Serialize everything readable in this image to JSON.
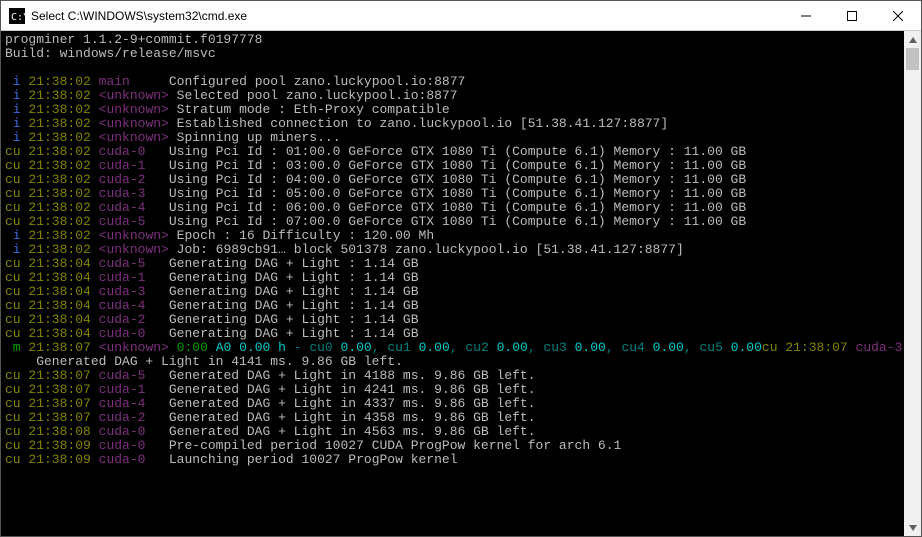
{
  "window": {
    "title": "Select C:\\WINDOWS\\system32\\cmd.exe"
  },
  "header": {
    "program": "progminer 1.1.2-9+commit.f0197778",
    "build": "Build: windows/release/msvc"
  },
  "pool_host": "zano.luckypool.io",
  "pool_port": "8877",
  "pool_ip": "51.38.41.127",
  "ts": {
    "a": "21:38:02",
    "b": "21:38:04",
    "c": "21:38:07",
    "d": "21:38:08",
    "e": "21:38:09"
  },
  "tag": {
    "main": "main",
    "unknown": "<unknown>",
    "c0": "cuda-0",
    "c1": "cuda-1",
    "c2": "cuda-2",
    "c3": "cuda-3",
    "c4": "cuda-4",
    "c5": "cuda-5"
  },
  "msg": {
    "cfg": "Configured pool zano.luckypool.io:8877",
    "sel": "Selected pool zano.luckypool.io:8877",
    "mode": "Stratum mode : Eth-Proxy compatible",
    "est": "Established connection to zano.luckypool.io [51.38.41.127:8877]",
    "spin": "Spinning up miners...",
    "pci0": "Using Pci Id : 01:00.0 GeForce GTX 1080 Ti (Compute 6.1) Memory : 11.00 GB",
    "pci1": "Using Pci Id : 03:00.0 GeForce GTX 1080 Ti (Compute 6.1) Memory : 11.00 GB",
    "pci2": "Using Pci Id : 04:00.0 GeForce GTX 1080 Ti (Compute 6.1) Memory : 11.00 GB",
    "pci3": "Using Pci Id : 05:00.0 GeForce GTX 1080 Ti (Compute 6.1) Memory : 11.00 GB",
    "pci4": "Using Pci Id : 06:00.0 GeForce GTX 1080 Ti (Compute 6.1) Memory : 11.00 GB",
    "pci5": "Using Pci Id : 07:00.0 GeForce GTX 1080 Ti (Compute 6.1) Memory : 11.00 GB",
    "epoch": "Epoch : 16 Difficulty : 120.00 Mh",
    "job": "Job: 6989cb91… block 501378 zano.luckypool.io [51.38.41.127:8877]",
    "gen": "Generating DAG + Light : 1.14 GB",
    "hash_a": "0:00",
    "hash_b": "A0 ",
    "hash_c": "0.00 h",
    "hash_d": " - cu0 ",
    "hash_e": ", cu1 ",
    "hash_f": ", cu2 ",
    "hash_g": ", cu3 ",
    "hash_h": ", cu4 ",
    "hash_i": ", cu5 ",
    "zero": "0.00",
    "wrap_tag": "cu ",
    "wrap_ts": "21:38:07 ",
    "wrap_cuda": "cuda-3",
    "wrap2": "    Generated DAG + Light in 4141 ms. 9.86 GB left.",
    "g5": "Generated DAG + Light in 4188 ms. 9.86 GB left.",
    "g1": "Generated DAG + Light in 4241 ms. 9.86 GB left.",
    "g4": "Generated DAG + Light in 4337 ms. 9.86 GB left.",
    "g2": "Generated DAG + Light in 4358 ms. 9.86 GB left.",
    "g0": "Generated DAG + Light in 4563 ms. 9.86 GB left.",
    "pre": "Pre-compiled period 10027 CUDA ProgPow kernel for arch 6.1",
    "launch": "Launching period 10027 ProgPow kernel"
  }
}
